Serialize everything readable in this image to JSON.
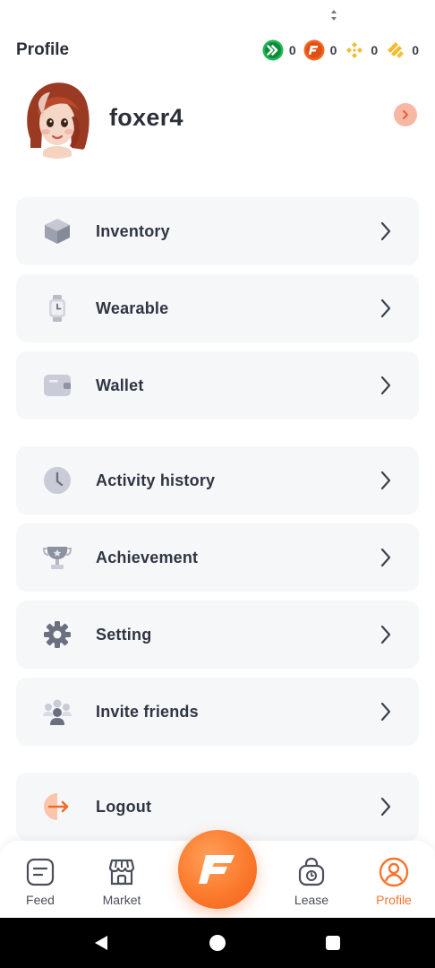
{
  "header": {
    "title": "Profile",
    "tokens": [
      {
        "icon": "green-arrow-token-icon",
        "amount": "0",
        "color": "#1db954"
      },
      {
        "icon": "orange-f-token-icon",
        "amount": "0",
        "color": "#f26722"
      },
      {
        "icon": "bnb-token-icon",
        "amount": "0",
        "color": "#f3ba2f"
      },
      {
        "icon": "busd-token-icon",
        "amount": "0",
        "color": "#f3ba2f"
      }
    ]
  },
  "profile": {
    "username": "foxer4",
    "avatar": "avatar-icon"
  },
  "menu": [
    {
      "label": "Inventory",
      "icon": "cube-icon"
    },
    {
      "label": "Wearable",
      "icon": "watch-icon"
    },
    {
      "label": "Wallet",
      "icon": "wallet-icon"
    },
    {
      "label": "Activity history",
      "icon": "clock-icon"
    },
    {
      "label": "Achievement",
      "icon": "trophy-icon"
    },
    {
      "label": "Setting",
      "icon": "gear-icon"
    },
    {
      "label": "Invite friends",
      "icon": "people-icon"
    },
    {
      "label": "Logout",
      "icon": "logout-icon"
    }
  ],
  "nav": {
    "items": [
      {
        "label": "Feed",
        "icon": "feed-icon"
      },
      {
        "label": "Market",
        "icon": "market-icon"
      },
      {
        "label": "Lease",
        "icon": "lease-icon"
      },
      {
        "label": "Profile",
        "icon": "profile-icon"
      }
    ],
    "active": "Profile",
    "accent": "#f7742e"
  }
}
